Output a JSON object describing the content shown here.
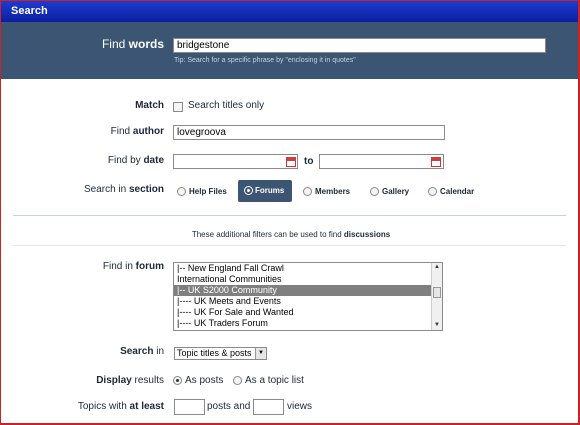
{
  "window": {
    "title": "Search"
  },
  "find_words": {
    "label_prefix": "Find ",
    "label_bold": "words",
    "value": "bridgestone",
    "tip": "Tip: Search for a specific phrase by \"enclosing it in quotes\""
  },
  "match": {
    "label": "Match",
    "checkbox_label": "Search titles only",
    "checked": false
  },
  "find_author": {
    "label_prefix": "Find ",
    "label_bold": "author",
    "value": "lovegroova"
  },
  "find_date": {
    "label_prefix": "Find by ",
    "label_bold": "date",
    "from_value": "",
    "to_label": "to",
    "to_value": ""
  },
  "section": {
    "label_prefix": "Search in ",
    "label_bold": "section",
    "options": [
      "Help Files",
      "Forums",
      "Members",
      "Gallery",
      "Calendar"
    ],
    "selected": "Forums"
  },
  "filters_note": {
    "prefix": "These additional filters can be used to find ",
    "bold": "discussions"
  },
  "find_forum": {
    "label_prefix": "Find in ",
    "label_bold": "forum",
    "items": [
      "|-- New England Fall Crawl",
      "International Communities",
      "|-- UK S2000 Community",
      "|---- UK Meets and Events",
      "|---- UK For Sale and Wanted",
      "|---- UK Traders Forum"
    ],
    "selected_index": 2
  },
  "search_in": {
    "label_prefix": "",
    "label_bold": "Search",
    "label_suffix": " in",
    "value": "Topic titles & posts"
  },
  "display": {
    "label_bold": "Display",
    "label_suffix": " results",
    "options": [
      "As posts",
      "As a topic list"
    ],
    "selected": "As posts"
  },
  "topics_least": {
    "label_prefix": "Topics with ",
    "label_bold": "at least",
    "posts_label": "posts and",
    "views_label": "views",
    "posts_value": "",
    "views_value": ""
  },
  "colors": {
    "titlebar": "#0b1f9e",
    "band": "#3b5572",
    "frame_border": "#cc2222"
  }
}
